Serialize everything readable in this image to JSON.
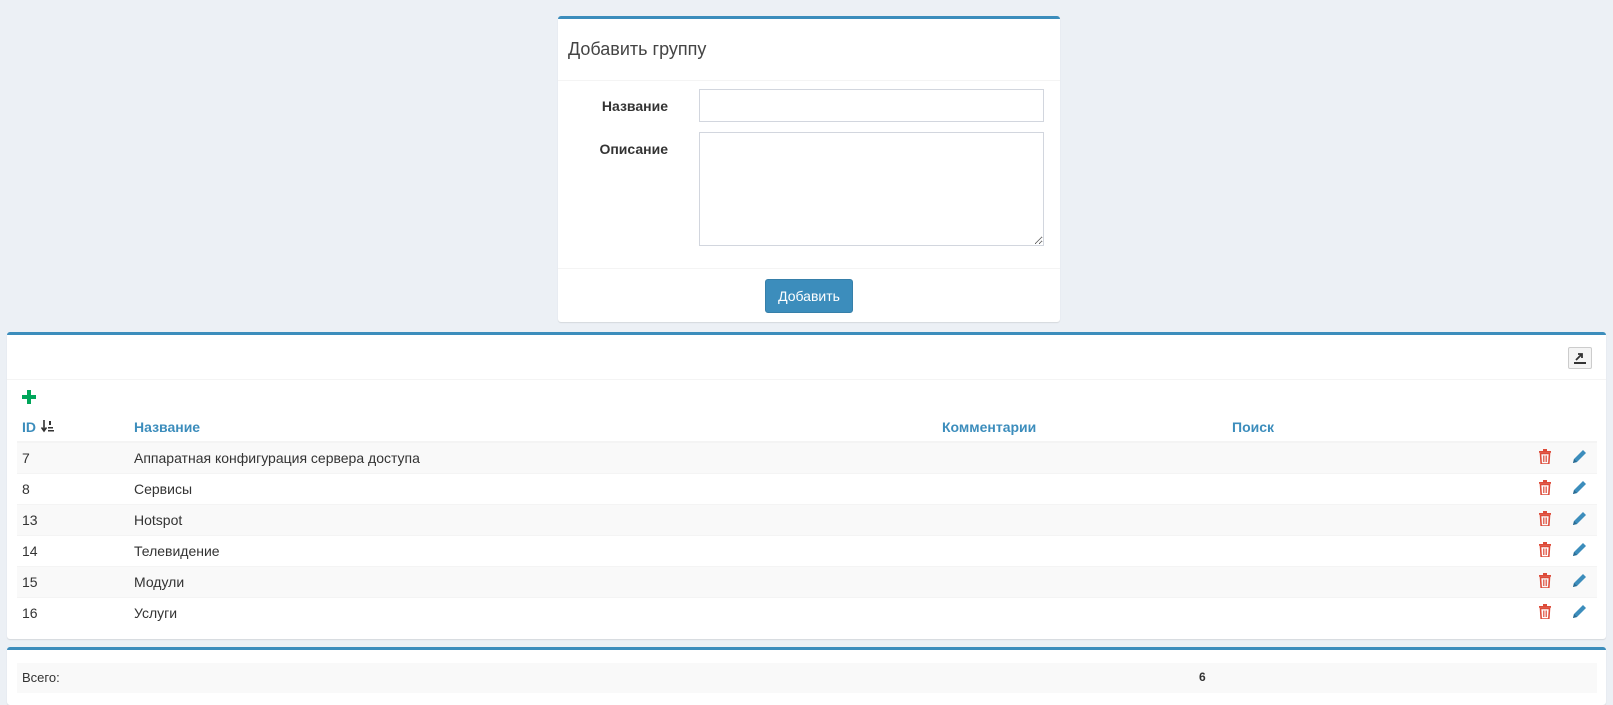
{
  "add_group_form": {
    "title": "Добавить группу",
    "name_label": "Название",
    "name_value": "",
    "description_label": "Описание",
    "description_value": "",
    "submit_label": "Добавить"
  },
  "groups_table": {
    "headers": {
      "id": "ID",
      "name": "Название",
      "comments": "Комментарии",
      "search": "Поиск"
    },
    "sort_icon": "sort-numeric-asc-icon",
    "rows": [
      {
        "id": "7",
        "name": "Аппаратная конфигурация сервера доступа",
        "comments": "",
        "search": ""
      },
      {
        "id": "8",
        "name": "Сервисы",
        "comments": "",
        "search": ""
      },
      {
        "id": "13",
        "name": "Hotspot",
        "comments": "",
        "search": ""
      },
      {
        "id": "14",
        "name": "Телевидение",
        "comments": "",
        "search": ""
      },
      {
        "id": "15",
        "name": "Модули",
        "comments": "",
        "search": ""
      },
      {
        "id": "16",
        "name": "Услуги",
        "comments": "",
        "search": ""
      }
    ],
    "row_actions": [
      "trash-icon",
      "pencil-icon"
    ]
  },
  "totals": {
    "label": "Всего:",
    "value": "6"
  },
  "colors": {
    "accent": "#3c8dbc",
    "add": "#00a65a",
    "delete": "#dd4b39",
    "background": "#ecf0f5"
  }
}
